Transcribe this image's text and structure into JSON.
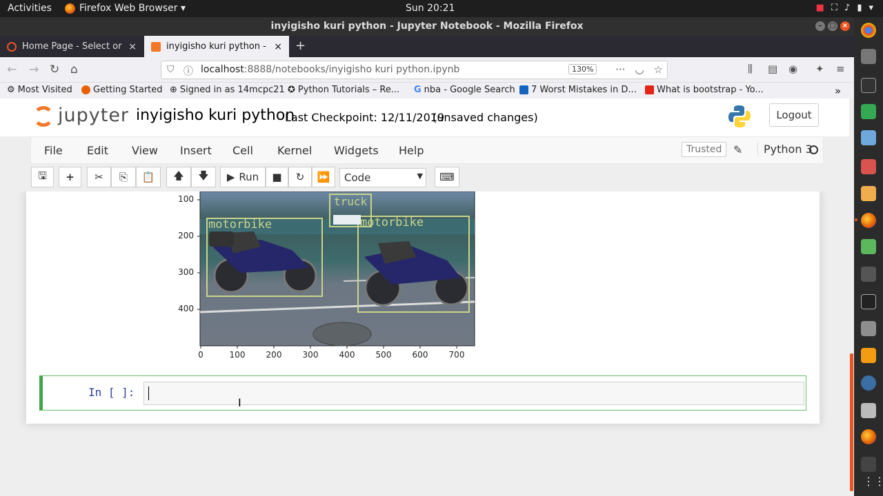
{
  "topbar": {
    "activities": "Activities",
    "app_name": "Firefox Web Browser ▾",
    "clock": "Sun 20:21",
    "tray_icons": [
      "record-icon",
      "network-icon",
      "volume-icon",
      "battery-icon",
      "power-menu-icon"
    ]
  },
  "window": {
    "title": "inyigisho kuri python - Jupyter Notebook - Mozilla Firefox"
  },
  "tabs": [
    {
      "label": "Home Page - Select or cr",
      "active": false
    },
    {
      "label": "inyigisho kuri python - Ju",
      "active": true
    }
  ],
  "navbar": {
    "url_host": "localhost",
    "url_rest": ":8888/notebooks/inyigisho kuri python.ipynb",
    "zoom": "130%"
  },
  "bookmarks": [
    "Most Visited",
    "Getting Started",
    "Signed in as 14mcpc21",
    "Python Tutorials – Re...",
    "nba - Google Search",
    "7 Worst Mistakes in D...",
    "What is bootstrap - Yo..."
  ],
  "jupyter": {
    "logo_text": "jupyter",
    "notebook_name": "inyigisho kuri python",
    "checkpoint": "Last Checkpoint: 12/11/2019",
    "unsaved": "(unsaved changes)",
    "logout": "Logout",
    "menus": [
      "File",
      "Edit",
      "View",
      "Insert",
      "Cell",
      "Kernel",
      "Widgets",
      "Help"
    ],
    "trusted": "Trusted",
    "kernel": "Python 3",
    "run_label": "Run",
    "cell_type": "Code",
    "prompt": "In [ ]:"
  },
  "output_image": {
    "labels": [
      "truck",
      "motorbike",
      "motorbike"
    ],
    "y_ticks": [
      "100",
      "200",
      "300",
      "400"
    ],
    "x_ticks": [
      "0",
      "100",
      "200",
      "300",
      "400",
      "500",
      "600",
      "700"
    ],
    "colors": {
      "box": "#cdd48a",
      "accent": "#e95420",
      "cell_border": "#42a548"
    }
  }
}
